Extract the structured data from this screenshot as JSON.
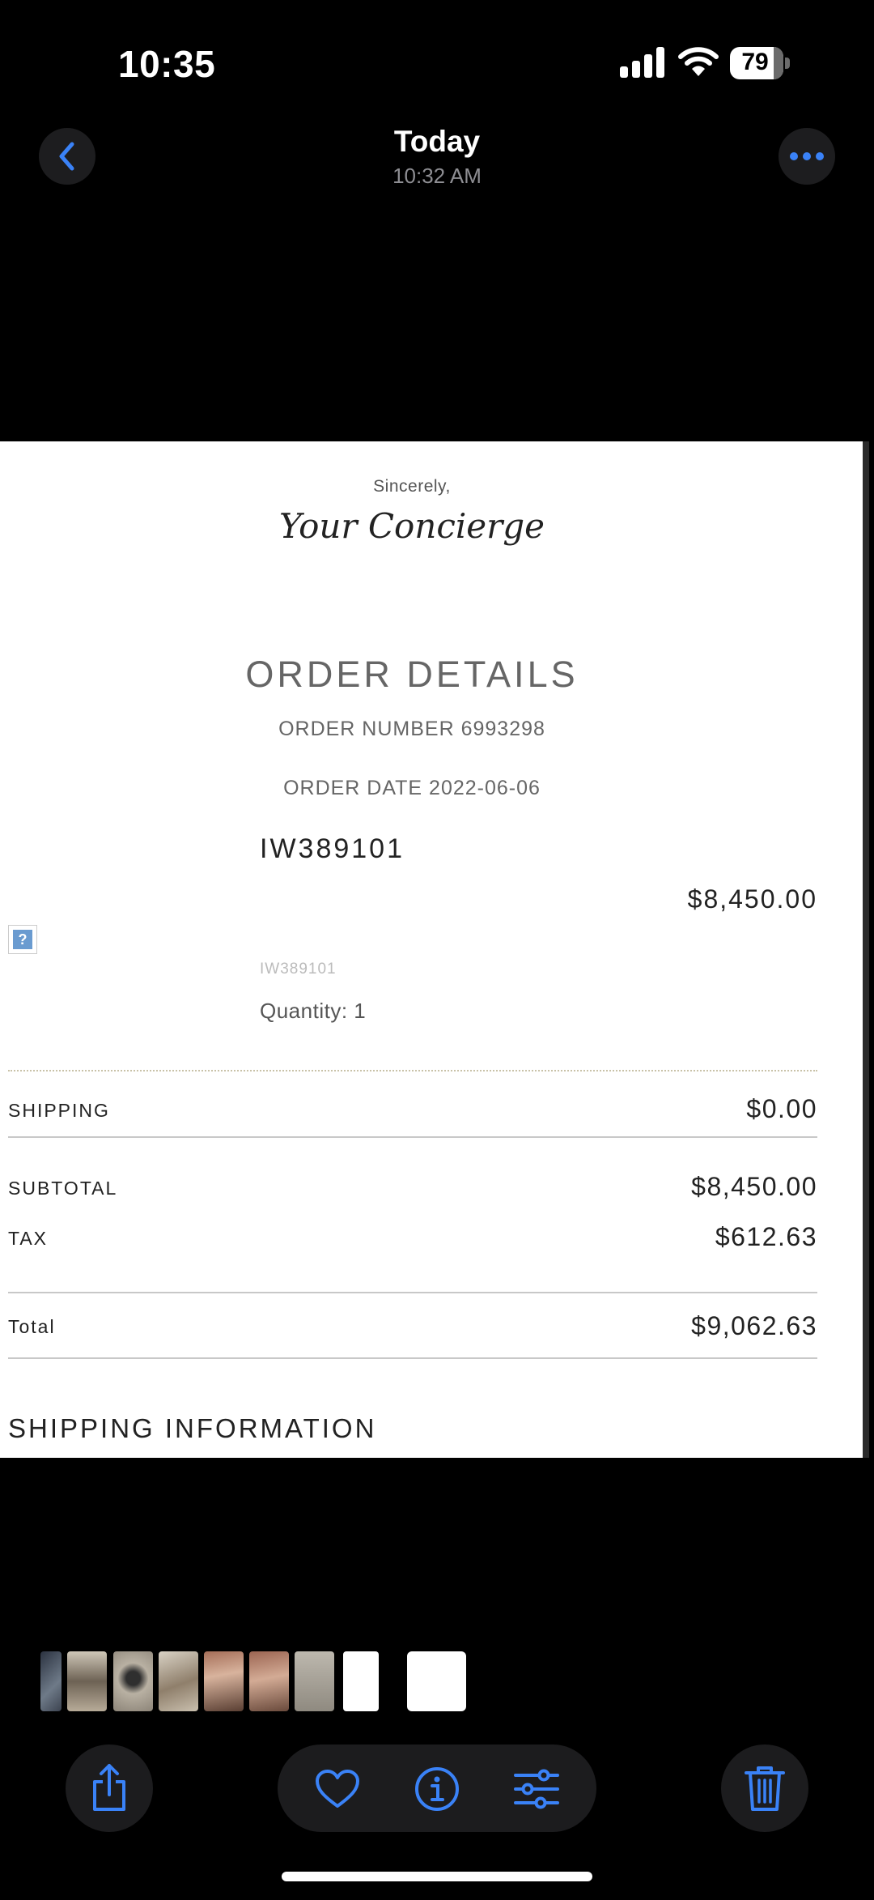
{
  "status_bar": {
    "time": "10:35",
    "battery": "79"
  },
  "header": {
    "title": "Today",
    "subtitle": "10:32 AM"
  },
  "colors": {
    "accent": "#3a82f7",
    "background": "#000000",
    "button_bg": "#1c1c1e"
  },
  "document": {
    "sincerely": "Sincerely,",
    "signature": "Your Concierge",
    "order_title": "ORDER DETAILS",
    "order_number": "ORDER NUMBER 6993298",
    "order_date": "ORDER DATE 2022-06-06",
    "item_sku": "IW389101",
    "item_price": "$8,450.00",
    "item_sku_small": "IW389101",
    "quantity": "Quantity: 1",
    "shipping_label": "SHIPPING",
    "shipping_value": "$0.00",
    "subtotal_label": "SUBTOTAL",
    "subtotal_value": "$8,450.00",
    "tax_label": "TAX",
    "tax_value": "$612.63",
    "total_label": "Total",
    "total_value": "$9,062.63",
    "shipping_info": "SHIPPING INFORMATION"
  },
  "thumbnails": [
    "photo-thumbnail",
    "photo-thumbnail",
    "photo-thumbnail",
    "photo-thumbnail",
    "photo-thumbnail",
    "photo-thumbnail",
    "photo-thumbnail",
    "receipt-thumbnail",
    "receipt-thumbnail-current"
  ],
  "toolbar": {
    "icons": [
      "share-icon",
      "heart-icon",
      "info-icon",
      "adjust-icon",
      "trash-icon"
    ]
  }
}
